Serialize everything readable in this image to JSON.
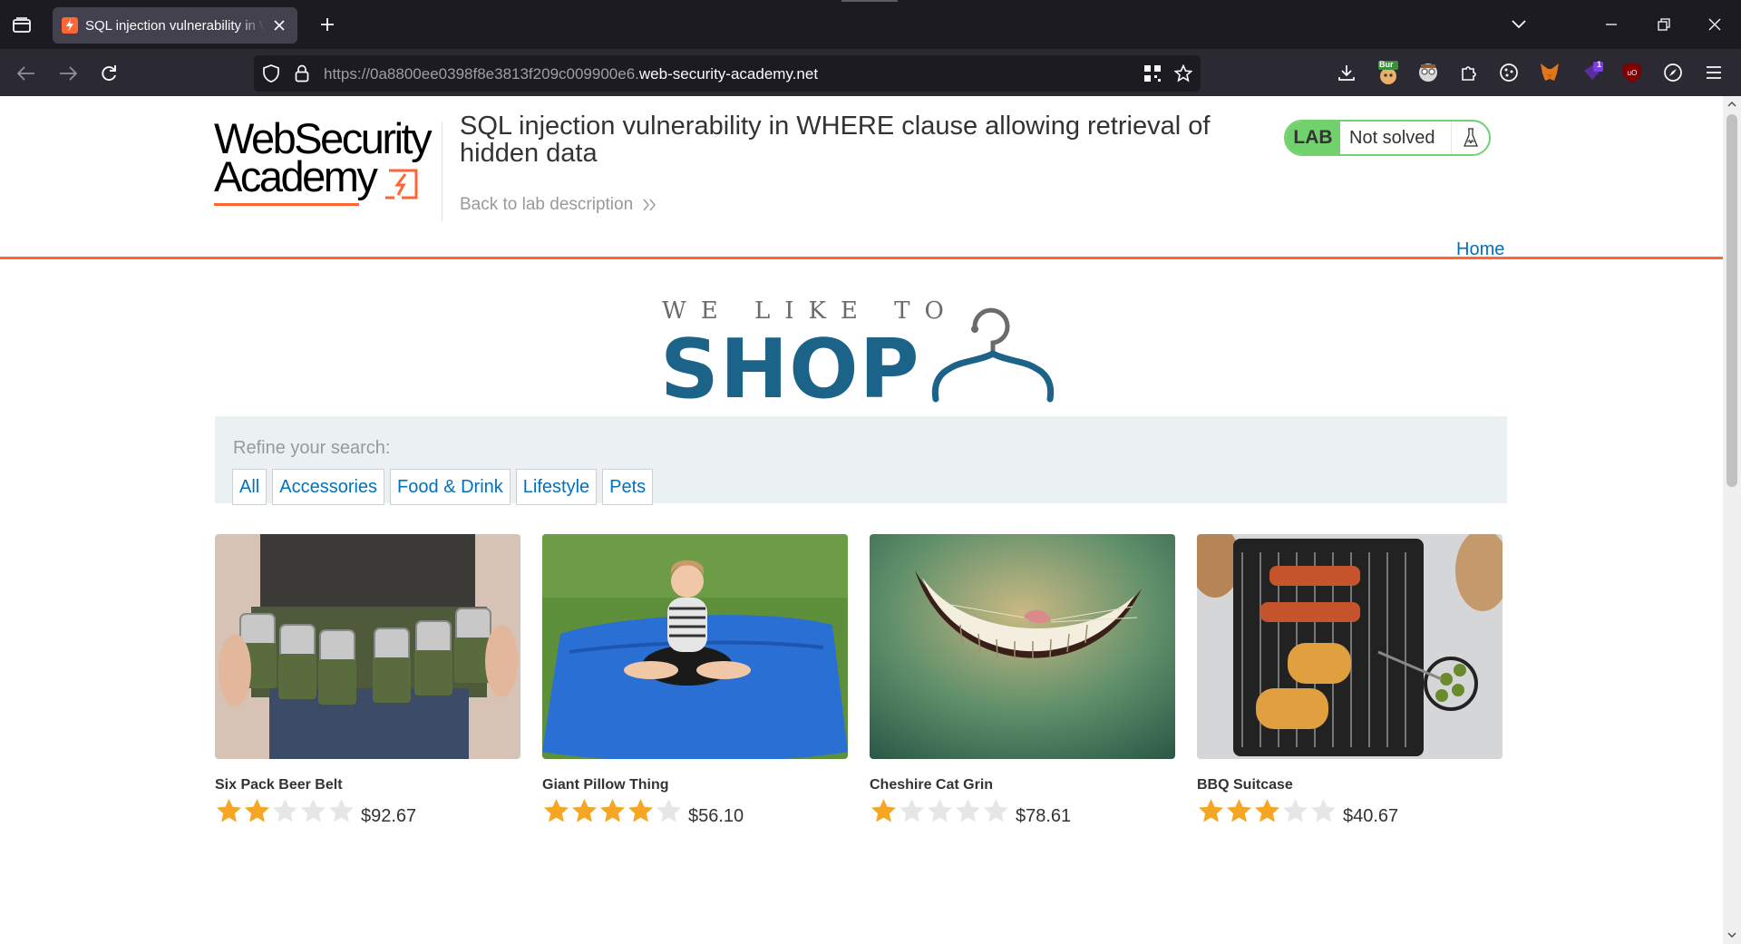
{
  "browser": {
    "tab_title": "SQL injection vulnerability in WHERE clause allowing retrieval of hidden data",
    "url_prefix": "https://0a8800ee0398f8e3813f209c009900e6.",
    "url_host": "web-security-academy.net",
    "extension_badges": {
      "burp": "Bur",
      "counter": "1"
    }
  },
  "header": {
    "logo_line1": "WebSecurity",
    "logo_line2": "Academy",
    "lab_title": "SQL injection vulnerability in WHERE clause allowing retrieval of hidden data",
    "back_link": "Back to lab description",
    "lab_badge": "LAB",
    "lab_status": "Not solved"
  },
  "nav": {
    "home": "Home"
  },
  "shop_logo": {
    "top_text": "WE LIKE TO",
    "main_text": "SHOP"
  },
  "filter": {
    "label": "Refine your search:",
    "categories": [
      "All",
      "Accessories",
      "Food & Drink",
      "Lifestyle",
      "Pets"
    ]
  },
  "products": [
    {
      "name": "Six Pack Beer Belt",
      "rating": 2,
      "price": "$92.67"
    },
    {
      "name": "Giant Pillow Thing",
      "rating": 4,
      "price": "$56.10"
    },
    {
      "name": "Cheshire Cat Grin",
      "rating": 1,
      "price": "$78.61"
    },
    {
      "name": "BBQ Suitcase",
      "rating": 3,
      "price": "$40.67"
    }
  ],
  "colors": {
    "accent_orange": "#ff6633",
    "link_blue": "#0071bc",
    "shop_blue": "#1b6388",
    "lab_green": "#70d16d",
    "star_gold": "#f5a623",
    "star_grey": "#e6e6e6"
  }
}
